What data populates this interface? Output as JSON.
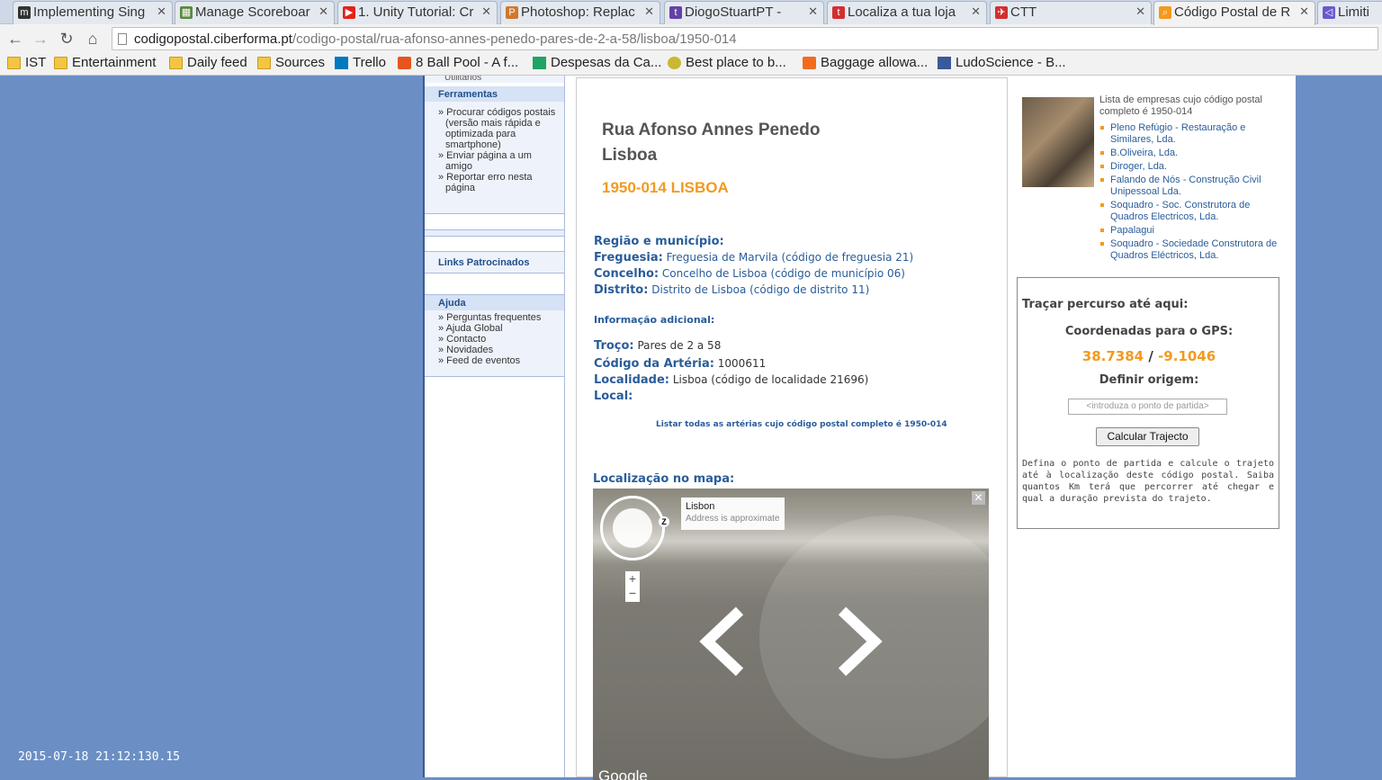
{
  "tabs": [
    {
      "title": "Implementing Sing",
      "icon": "medium-icon",
      "color": "#333333"
    },
    {
      "title": "Manage Scoreboar",
      "icon": "scoreboard-icon",
      "color": "#5a8a3c"
    },
    {
      "title": "1. Unity Tutorial: Cr",
      "icon": "youtube-icon",
      "color": "#e62117"
    },
    {
      "title": "Photoshop: Replac",
      "icon": "photoshop-icon",
      "color": "#d0782c"
    },
    {
      "title": "DiogoStuartPT -",
      "icon": "twitch-icon",
      "color": "#6441a5"
    },
    {
      "title": "Localiza a tua loja",
      "icon": "store-icon",
      "color": "#d32f2f"
    },
    {
      "title": "CTT",
      "icon": "ctt-icon",
      "color": "#d32f2f"
    },
    {
      "title": "Código Postal de R",
      "icon": "postcode-icon",
      "color": "#f39a1e"
    },
    {
      "title": "Limitin",
      "icon": "vs-icon",
      "color": "#6a5acd"
    }
  ],
  "url": {
    "domain": "codigopostal.ciberforma.pt",
    "path": "/codigo-postal/rua-afonso-annes-penedo-pares-de-2-a-58/lisboa/1950-014"
  },
  "bookmarks": [
    {
      "label": "IST"
    },
    {
      "label": "Entertainment"
    },
    {
      "label": "Daily feed"
    },
    {
      "label": "Sources"
    },
    {
      "label": "Trello"
    },
    {
      "label": "8 Ball Pool - A f..."
    },
    {
      "label": "Despesas da Ca..."
    },
    {
      "label": "Best place to b..."
    },
    {
      "label": "Baggage allowa..."
    },
    {
      "label": "LudoScience - B..."
    }
  ],
  "sidebar": {
    "partial_top": "Utilitários",
    "ferramentas_title": "Ferramentas",
    "ferramentas_items": [
      "» Procurar códigos postais (versão mais rápida e optimizada para smartphone)",
      "» Enviar página a um amigo",
      "» Reportar erro nesta página"
    ],
    "links_title": "Links Patrocinados",
    "ajuda_title": "Ajuda",
    "ajuda_items": [
      "» Perguntas frequentes",
      "» Ajuda Global",
      "» Contacto",
      "» Novidades",
      "» Feed de eventos"
    ]
  },
  "main": {
    "street": "Rua Afonso Annes Penedo",
    "city": "Lisboa",
    "postcode": "1950-014 LISBOA",
    "region_title": "Região e município:",
    "freguesia_label": "Freguesia:",
    "freguesia_value": "Freguesia de Marvila (código de freguesia 21)",
    "concelho_label": "Concelho:",
    "concelho_value": "Concelho de Lisboa (código de município 06)",
    "distrito_label": "Distrito:",
    "distrito_value": "Distrito de Lisboa (código de distrito 11)",
    "info_title": "Informação adicional:",
    "troco_label": "Troço:",
    "troco_value": "Pares de 2 a 58",
    "arteria_label": "Código da Artéria:",
    "arteria_value": "1000611",
    "localidade_label": "Localidade:",
    "localidade_value": "Lisboa (código de localidade 21696)",
    "local_label": "Local:",
    "list_link": "Listar todas as artérias cujo código postal completo é 1950-014",
    "map_title": "Localização no mapa:",
    "map_tip_title": "Lisbon",
    "map_tip_sub": "Address is approximate",
    "map_brand": "Google"
  },
  "right": {
    "companies_intro": "Lista de empresas cujo código postal completo é 1950-014",
    "companies": [
      "Pleno Refúgio - Restauração e Similares, Lda.",
      "B.Oliveira, Lda.",
      "Diroger, Lda.",
      "Falando de Nós - Construção Civil Unipessoal Lda.",
      "Soquadro - Soc. Construtora de Quadros Electricos, Lda.",
      "Papalagui",
      "Soquadro - Sociedade Construtora de Quadros Eléctricos, Lda."
    ],
    "route_title": "Traçar percurso até aqui:",
    "gps_label": "Coordenadas para o GPS:",
    "lat": "38.7384",
    "lon": "-9.1046",
    "origin_label": "Definir origem:",
    "origin_placeholder": "<introduza o ponto de partida>",
    "calc_button": "Calcular Trajecto",
    "route_desc": "Defina o ponto de partida e calcule o trajeto até à localização deste código postal. Saiba quantos Km terá que percorrer até chegar e qual a duração prevista do trajeto."
  },
  "timestamp": "2015-07-18 21:12:130.15"
}
